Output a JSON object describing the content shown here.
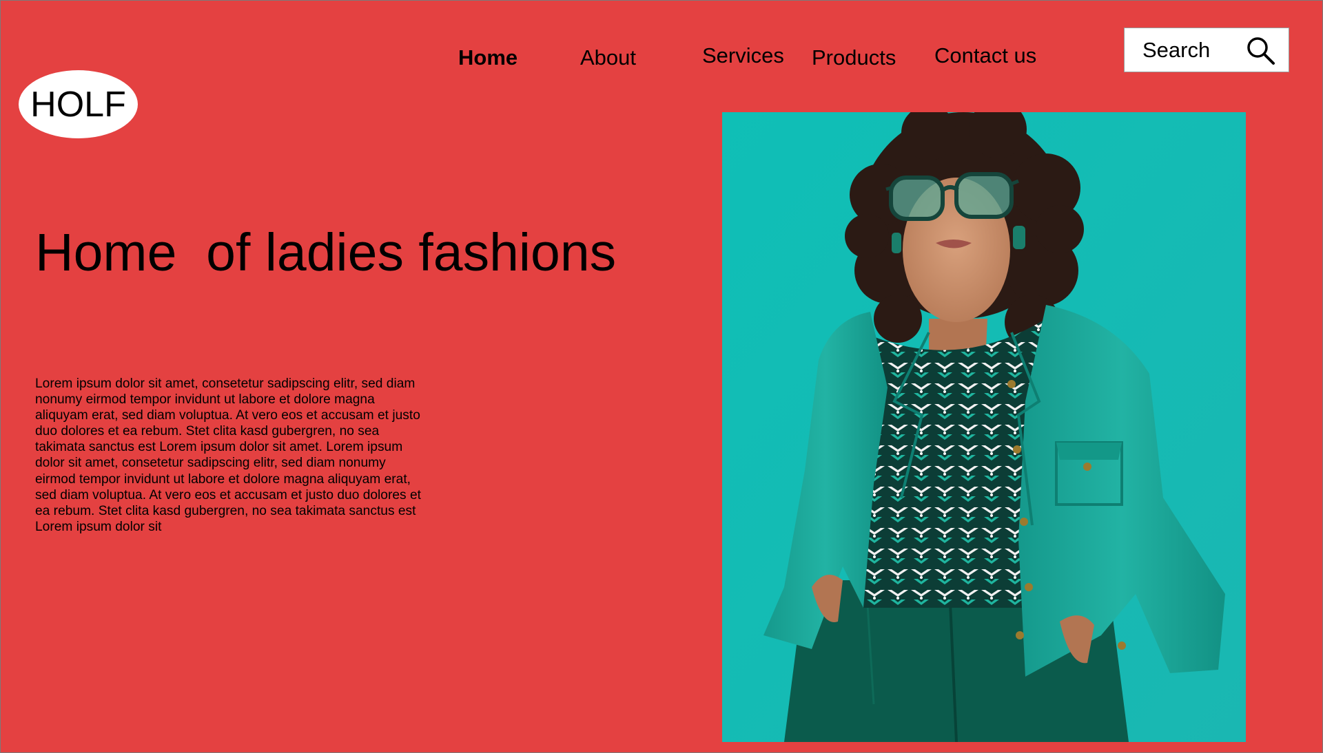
{
  "logo": {
    "text": "HOLF"
  },
  "nav": {
    "home": "Home",
    "about": "About",
    "services": "Services",
    "products": "Products",
    "contact": "Contact us"
  },
  "search": {
    "placeholder": "Search",
    "icon": "search-icon"
  },
  "hero": {
    "title": "Home  of ladies fashions",
    "body": "Lorem ipsum dolor sit amet, consetetur sadipscing elitr, sed diam nonumy eirmod tempor invidunt ut labore et dolore magna aliquyam erat, sed diam voluptua. At vero eos et accusam et justo duo dolores et ea rebum. Stet clita kasd gubergren, no sea takimata sanctus est Lorem ipsum dolor sit amet. Lorem ipsum dolor sit amet, consetetur sadipscing elitr, sed diam nonumy eirmod tempor invidunt ut labore et dolore magna aliquyam erat, sed diam voluptua. At vero eos et accusam et justo duo dolores et ea rebum. Stet clita kasd gubergren, no sea takimata sanctus est Lorem ipsum dolor sit"
  },
  "colors": {
    "background": "#e44141",
    "photo_background": "#10bcb4",
    "jacket": "#1aa89a",
    "trousers": "#0b5b4c",
    "text": "#000000",
    "search_background": "#ffffff"
  }
}
